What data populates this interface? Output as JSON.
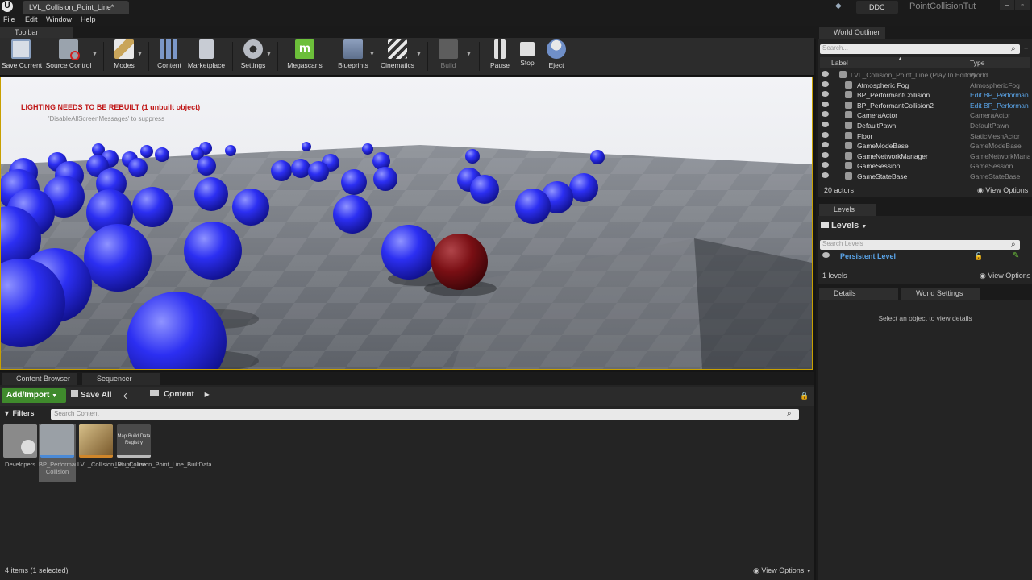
{
  "titlebar": {
    "document_tab": "LVL_Collision_Point_Line*",
    "ddc_label": "DDC",
    "project_name": "PointCollisionTut",
    "logo": "U"
  },
  "menu": [
    "File",
    "Edit",
    "Window",
    "Help"
  ],
  "toolbar": {
    "tab_label": "Toolbar",
    "buttons": [
      {
        "label": "Save Current",
        "icon": "save-icon"
      },
      {
        "label": "Source Control",
        "icon": "source-control-icon"
      },
      {
        "label": "Modes",
        "icon": "modes-icon"
      },
      {
        "label": "Content",
        "icon": "content-icon"
      },
      {
        "label": "Marketplace",
        "icon": "marketplace-icon"
      },
      {
        "label": "Settings",
        "icon": "settings-icon"
      },
      {
        "label": "Megascans",
        "icon": "megascans-icon"
      },
      {
        "label": "Blueprints",
        "icon": "blueprints-icon"
      },
      {
        "label": "Cinematics",
        "icon": "cinematics-icon"
      },
      {
        "label": "Build",
        "icon": "build-icon"
      },
      {
        "label": "Pause",
        "icon": "pause-icon"
      },
      {
        "label": "Stop",
        "icon": "stop-icon"
      },
      {
        "label": "Eject",
        "icon": "eject-icon"
      }
    ]
  },
  "viewport": {
    "warning": "LIGHTING NEEDS TO BE REBUILT (1 unbuilt object)",
    "suppress": "'DisableAllScreenMessages' to suppress"
  },
  "content_browser": {
    "tabs": [
      "Content Browser",
      "Sequencer"
    ],
    "add_import": "Add/Import",
    "save_all": "Save All",
    "path": "Content",
    "filters": "Filters",
    "search_placeholder": "Search Content",
    "assets": [
      {
        "label": "Developers"
      },
      {
        "label": "BP_Performant Collision"
      },
      {
        "label": "LVL_Collision_Point_Line"
      },
      {
        "label": "LVL_Collision_Point_Line_BuiltData",
        "thumb_text": "Map Build Data Registry"
      }
    ],
    "status": "4 items (1 selected)",
    "view_options": "View Options"
  },
  "outliner": {
    "tab": "World Outliner",
    "search_placeholder": "Search...",
    "col_label": "Label",
    "col_type": "Type",
    "rows": [
      {
        "label": "LVL_Collision_Point_Line (Play In Editor)",
        "type": "World",
        "root": true
      },
      {
        "label": "Atmospheric Fog",
        "type": "AtmosphericFog"
      },
      {
        "label": "BP_PerformantCollision",
        "type": "Edit BP_Performan",
        "link": true
      },
      {
        "label": "BP_PerformantCollision2",
        "type": "Edit BP_Performan",
        "link": true
      },
      {
        "label": "CameraActor",
        "type": "CameraActor"
      },
      {
        "label": "DefaultPawn",
        "type": "DefaultPawn"
      },
      {
        "label": "Floor",
        "type": "StaticMeshActor"
      },
      {
        "label": "GameModeBase",
        "type": "GameModeBase"
      },
      {
        "label": "GameNetworkManager",
        "type": "GameNetworkMana"
      },
      {
        "label": "GameSession",
        "type": "GameSession"
      },
      {
        "label": "GameStateBase",
        "type": "GameStateBase"
      }
    ],
    "actor_count": "20 actors",
    "view_options": "View Options"
  },
  "levels": {
    "tab": "Levels",
    "title": "Levels",
    "search_placeholder": "Search Levels",
    "persistent": "Persistent Level",
    "count": "1 levels",
    "view_options": "View Options"
  },
  "details": {
    "tab": "Details",
    "world_settings_tab": "World Settings",
    "empty_message": "Select an object to view details"
  },
  "colors": {
    "accent_green": "#3f8a2c",
    "link_blue": "#5aa4e8",
    "warning_red": "#c01818",
    "viewport_border": "#c8a000",
    "sphere_blue": "#2a2cf0",
    "sphere_red": "#7a0f14"
  }
}
